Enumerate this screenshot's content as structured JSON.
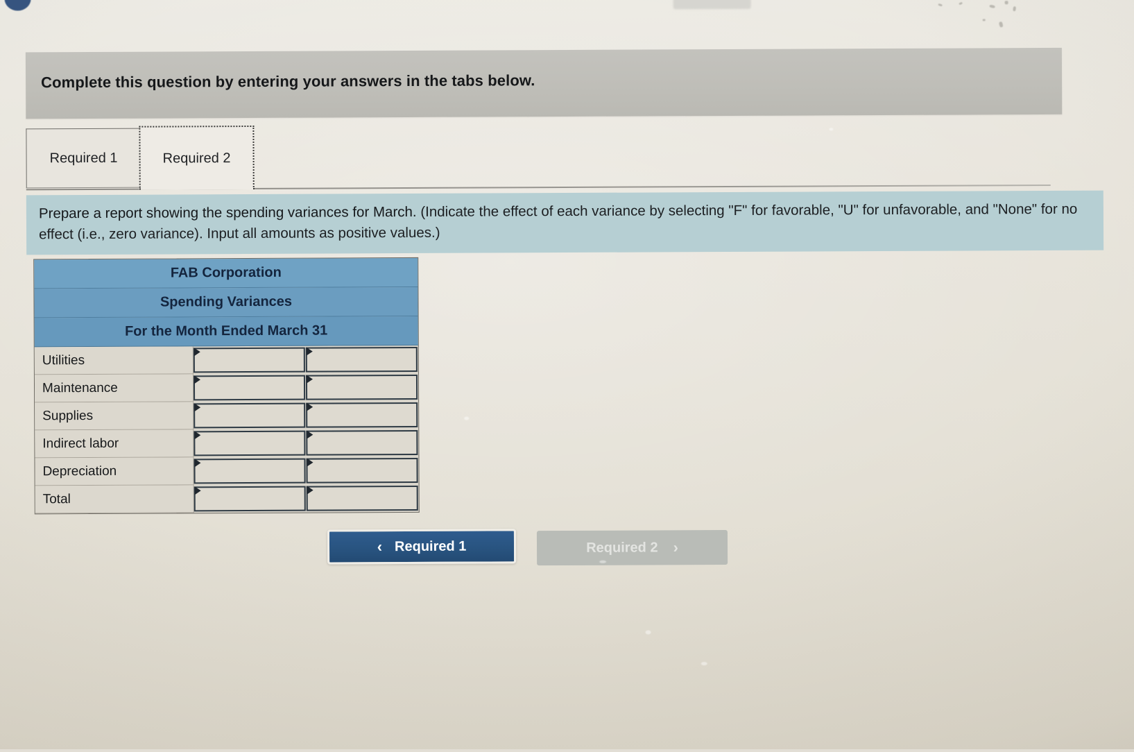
{
  "header": {
    "title": "Complete this question by entering your answers in the tabs below."
  },
  "tabs": [
    {
      "id": "required-1",
      "label": "Required 1",
      "active": false
    },
    {
      "id": "required-2",
      "label": "Required 2",
      "active": true
    }
  ],
  "instruction": {
    "lead": "Prepare a report showing the spending variances for March.",
    "paren": "(Indicate the effect of each variance by selecting \"F\" for favorable, \"U\" for unfavorable, and \"None\" for no effect (i.e., zero variance). Input all amounts as positive values.)"
  },
  "report": {
    "title_lines": [
      "FAB Corporation",
      "Spending Variances",
      "For the Month Ended March 31"
    ],
    "rows": [
      {
        "label": "Utilities",
        "amount": "",
        "effect": ""
      },
      {
        "label": "Maintenance",
        "amount": "",
        "effect": ""
      },
      {
        "label": "Supplies",
        "amount": "",
        "effect": ""
      },
      {
        "label": "Indirect labor",
        "amount": "",
        "effect": ""
      },
      {
        "label": "Depreciation",
        "amount": "",
        "effect": ""
      },
      {
        "label": "Total",
        "amount": "",
        "effect": ""
      }
    ]
  },
  "navigation": {
    "prev_label": "Required 1",
    "prev_icon": "chevron-left-icon",
    "prev_chevron": "‹",
    "next_label": "Required 2",
    "next_icon": "chevron-right-icon",
    "next_chevron": "›",
    "next_disabled": true
  },
  "colors": {
    "header_bar": "#bfbeb8",
    "instruction_band": "#b6cfd3",
    "table_header_blue": "#6699bd",
    "table_header_text": "#14253e",
    "primary_button": "#28537f",
    "disabled_button": "#b9bcb7",
    "page_background": "#e3dfd4"
  }
}
